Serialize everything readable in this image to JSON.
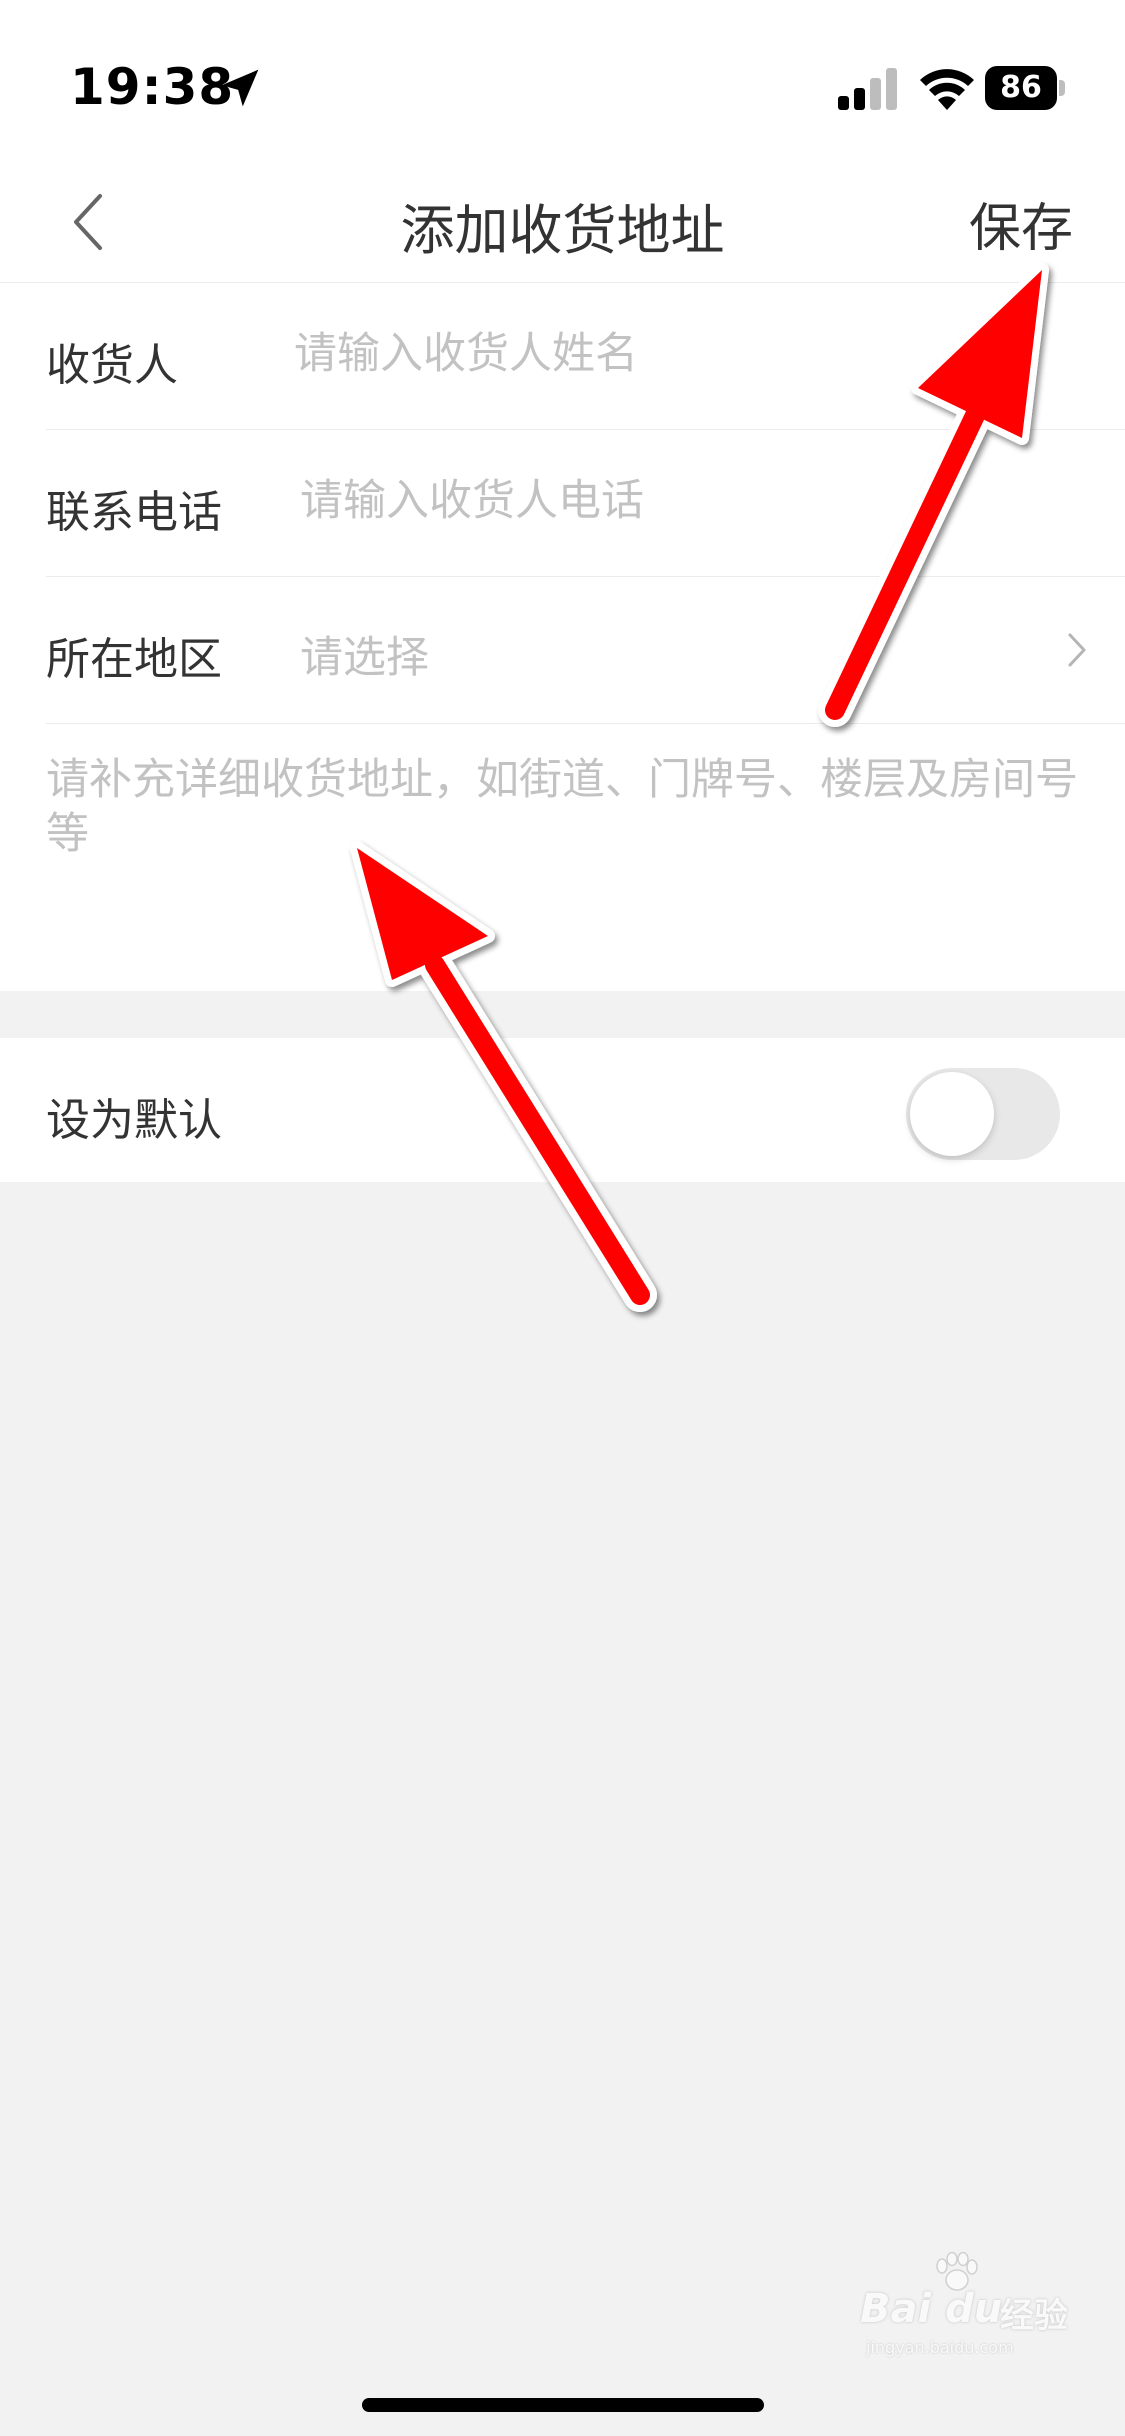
{
  "status_bar": {
    "time": "19:38",
    "battery_level": "86",
    "icons": [
      "location-arrow-icon",
      "cellular-signal-icon",
      "wifi-icon",
      "battery-icon"
    ]
  },
  "nav": {
    "title": "添加收货地址",
    "back_icon": "chevron-left-icon",
    "save_label": "保存"
  },
  "form": {
    "fields": [
      {
        "label": "收货人",
        "placeholder": "请输入收货人姓名",
        "value": ""
      },
      {
        "label": "联系电话",
        "placeholder": "请输入收货人电话",
        "value": ""
      },
      {
        "label": "所在地区",
        "placeholder": "请选择",
        "value": ""
      }
    ],
    "detail_placeholder": "请补充详细收货地址，如街道、门牌号、楼层及房间号等"
  },
  "default_toggle": {
    "label": "设为默认",
    "on": false
  },
  "watermark": {
    "brand": "Bai du",
    "brand_cn": "经验",
    "url": "jingyan.baidu.com"
  },
  "colors": {
    "annotation_arrow": "#ff0000",
    "background": "#f2f2f2",
    "surface": "#ffffff",
    "text": "#333333",
    "placeholder": "#c2c2c2"
  }
}
